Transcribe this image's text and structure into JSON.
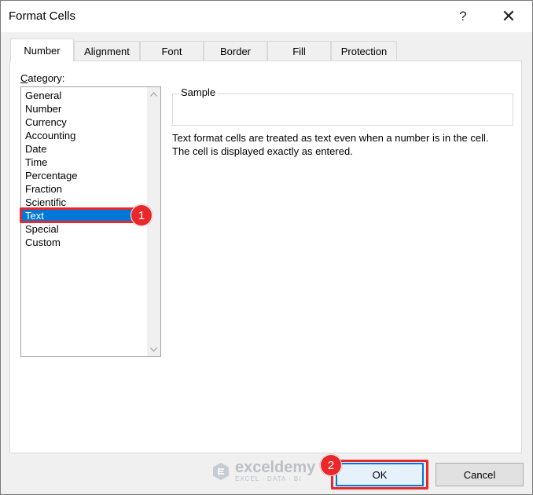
{
  "window": {
    "title": "Format Cells",
    "help_glyph": "?",
    "close_glyph": "✕"
  },
  "tabs": [
    {
      "label": "Number",
      "active": true
    },
    {
      "label": "Alignment",
      "active": false
    },
    {
      "label": "Font",
      "active": false
    },
    {
      "label": "Border",
      "active": false
    },
    {
      "label": "Fill",
      "active": false
    },
    {
      "label": "Protection",
      "active": false
    }
  ],
  "category": {
    "label_mnemonic": "C",
    "label_rest": "ategory:",
    "items": [
      "General",
      "Number",
      "Currency",
      "Accounting",
      "Date",
      "Time",
      "Percentage",
      "Fraction",
      "Scientific",
      "Text",
      "Special",
      "Custom"
    ],
    "selected": "Text"
  },
  "sample": {
    "legend": "Sample",
    "description_line1": "Text format cells are treated as text even when a number is in the cell.",
    "description_line2": "The cell is displayed exactly as entered."
  },
  "buttons": {
    "ok": "OK",
    "cancel": "Cancel"
  },
  "annotations": {
    "step1": "1",
    "step2": "2",
    "color": "#e8282b"
  },
  "watermark": {
    "name": "exceldemy",
    "tagline": "EXCEL · DATA · BI"
  },
  "colors": {
    "selection": "#0078d7",
    "default_button_border": "#0078d7"
  }
}
